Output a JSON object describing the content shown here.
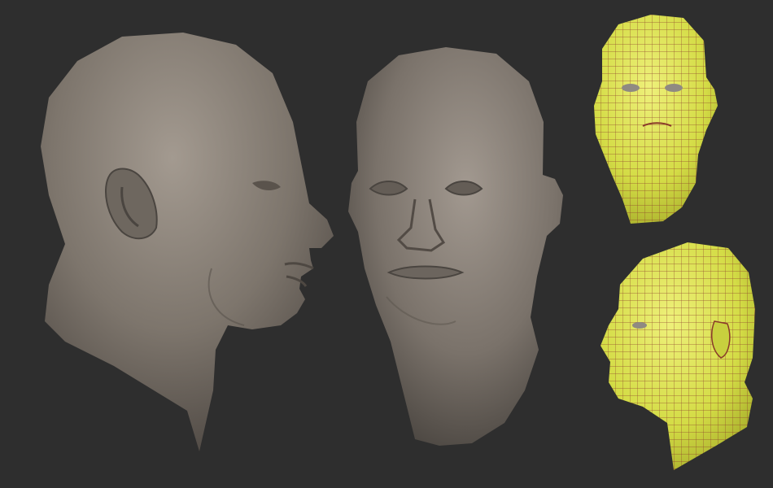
{
  "scene": {
    "background": "#2e2e2e",
    "description_free": true,
    "models": [
      {
        "id": "sculpt-profile",
        "view": "side",
        "material": "clay",
        "color": "#7a7269"
      },
      {
        "id": "sculpt-front",
        "view": "front",
        "material": "clay",
        "color": "#7a7269"
      },
      {
        "id": "wire-front",
        "view": "front",
        "material": "wireframe",
        "color": "#d6e04a",
        "wire_color": "#8a3a2a"
      },
      {
        "id": "wire-three-quarter",
        "view": "three-quarter",
        "material": "wireframe",
        "color": "#d6e04a",
        "wire_color": "#8a3a2a"
      }
    ]
  }
}
